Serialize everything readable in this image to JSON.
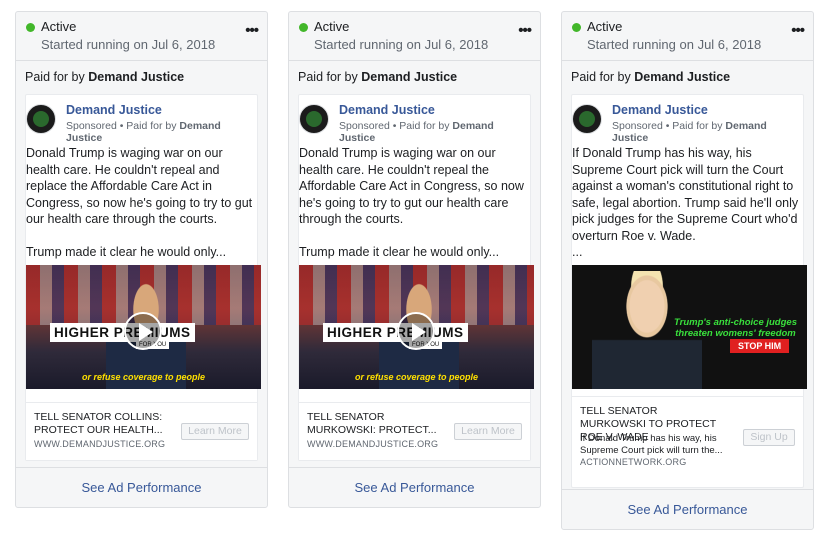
{
  "cards": [
    {
      "status": "Active",
      "started": "Started running on Jul 6, 2018",
      "more": "•••",
      "paid_prefix": "Paid for by ",
      "paid_by": "Demand Justice",
      "page_name": "Demand Justice",
      "sponsored": "Sponsored",
      "sponsored_paid": " • Paid for by ",
      "sponsored_paid_by": "Demand Justice",
      "ad_text": "Donald Trump is waging war on our health care. He couldn't repeal and replace the Affordable Care Act in Congress, so now he's going to try to gut our health care through the courts.\n\nTrump made it clear he would only...",
      "video_banner": "HIGHER PREMIUMS",
      "video_banner_sub": "FOR YOU",
      "video_caption": "or refuse coverage to people",
      "cta_title": "TELL SENATOR COLLINS: PROTECT OUR HEALTH...",
      "cta_domain": "WWW.DEMANDJUSTICE.ORG",
      "cta_button": "Learn More",
      "perf": "See Ad Performance"
    },
    {
      "status": "Active",
      "started": "Started running on Jul 6, 2018",
      "more": "•••",
      "paid_prefix": "Paid for by ",
      "paid_by": "Demand Justice",
      "page_name": "Demand Justice",
      "sponsored": "Sponsored",
      "sponsored_paid": " • Paid for by ",
      "sponsored_paid_by": "Demand Justice",
      "ad_text": "Donald Trump is waging war on our health care. He couldn't repeal the Affordable Care Act in Congress, so now he's going to try to gut our health care through the courts.\n\nTrump made it clear he would only...",
      "video_banner": "HIGHER PREMIUMS",
      "video_banner_sub": "FOR YOU",
      "video_caption": "or refuse coverage to people",
      "cta_title": "TELL SENATOR MURKOWSKI: PROTECT...",
      "cta_domain": "WWW.DEMANDJUSTICE.ORG",
      "cta_button": "Learn More",
      "perf": "See Ad Performance"
    },
    {
      "status": "Active",
      "started": "Started running on Jul 6, 2018",
      "more": "•••",
      "paid_prefix": "Paid for by ",
      "paid_by": "Demand Justice",
      "page_name": "Demand Justice",
      "sponsored": "Sponsored",
      "sponsored_paid": " • Paid for by ",
      "sponsored_paid_by": "Demand Justice",
      "ad_text": "If Donald Trump has his way, his Supreme Court pick will turn the Court against a woman's constitutional right to safe, legal abortion. Trump said he'll only pick judges for the Supreme Court who'd overturn Roe v. Wade.\n...",
      "image_headline": "Trump's anti-choice judges threaten womens' freedom",
      "image_stop": "STOP HIM",
      "cta_title": "TELL SENATOR MURKOWSKI TO PROTECT ROE V. WADE",
      "cta_desc": "If Donald Trump has his way, his Supreme Court pick will turn the...",
      "cta_domain": "ACTIONNETWORK.ORG",
      "cta_button": "Sign Up",
      "perf": "See Ad Performance"
    }
  ]
}
